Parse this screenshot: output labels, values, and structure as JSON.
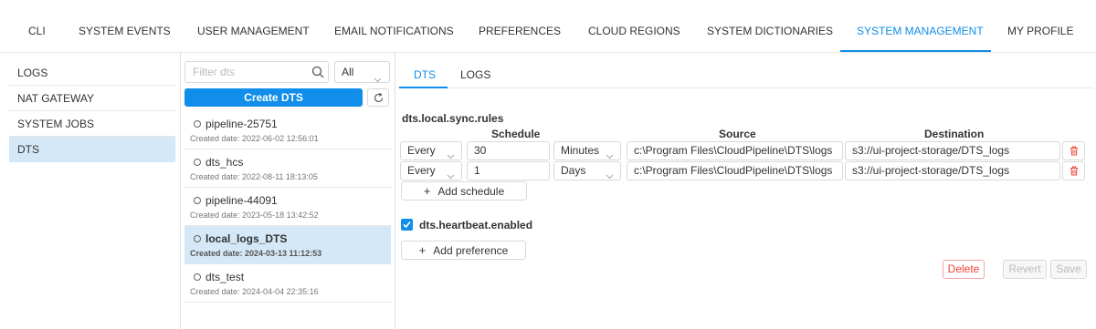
{
  "top_tabs": [
    {
      "label": "CLI"
    },
    {
      "label": "SYSTEM EVENTS"
    },
    {
      "label": "USER MANAGEMENT"
    },
    {
      "label": "EMAIL NOTIFICATIONS"
    },
    {
      "label": "PREFERENCES"
    },
    {
      "label": "CLOUD REGIONS"
    },
    {
      "label": "SYSTEM DICTIONARIES"
    },
    {
      "label": "SYSTEM MANAGEMENT",
      "active": true
    },
    {
      "label": "MY PROFILE"
    }
  ],
  "left_nav": [
    {
      "label": "LOGS"
    },
    {
      "label": "NAT GATEWAY"
    },
    {
      "label": "SYSTEM JOBS"
    },
    {
      "label": "DTS",
      "active": true
    }
  ],
  "filter": {
    "placeholder": "Filter dts",
    "type_select": "All"
  },
  "create_button": "Create DTS",
  "dts_list": [
    {
      "name": "pipeline-25751",
      "date": "Created date: 2022-06-02 12:56:01"
    },
    {
      "name": "dts_hcs",
      "date": "Created date: 2022-08-11 18:13:05"
    },
    {
      "name": "pipeline-44091",
      "date": "Created date: 2023-05-18 13:42:52"
    },
    {
      "name": "local_logs_DTS",
      "date": "Created date: 2024-03-13 11:12:53",
      "selected": true
    },
    {
      "name": "dts_test",
      "date": "Created date: 2024-04-04 22:35:16"
    }
  ],
  "sub_tabs": [
    {
      "label": "DTS",
      "active": true
    },
    {
      "label": "LOGS"
    }
  ],
  "sync_rules": {
    "title": "dts.local.sync.rules",
    "col_schedule": "Schedule",
    "col_source": "Source",
    "col_destination": "Destination",
    "rows": [
      {
        "every": "Every",
        "value": "30",
        "unit": "Minutes",
        "source": "c:\\Program Files\\CloudPipeline\\DTS\\logs",
        "destination": "s3://ui-project-storage/DTS_logs"
      },
      {
        "every": "Every",
        "value": "1",
        "unit": "Days",
        "source": "c:\\Program Files\\CloudPipeline\\DTS\\logs",
        "destination": "s3://ui-project-storage/DTS_logs"
      }
    ],
    "add_schedule": "Add schedule"
  },
  "heartbeat": {
    "label": "dts.heartbeat.enabled",
    "checked": true
  },
  "add_preference": "Add preference",
  "actions": {
    "delete": "Delete",
    "revert": "Revert",
    "save": "Save"
  },
  "colors": {
    "accent": "#108ee9",
    "selected_bg": "#d4e8f7",
    "danger": "#f04134"
  }
}
